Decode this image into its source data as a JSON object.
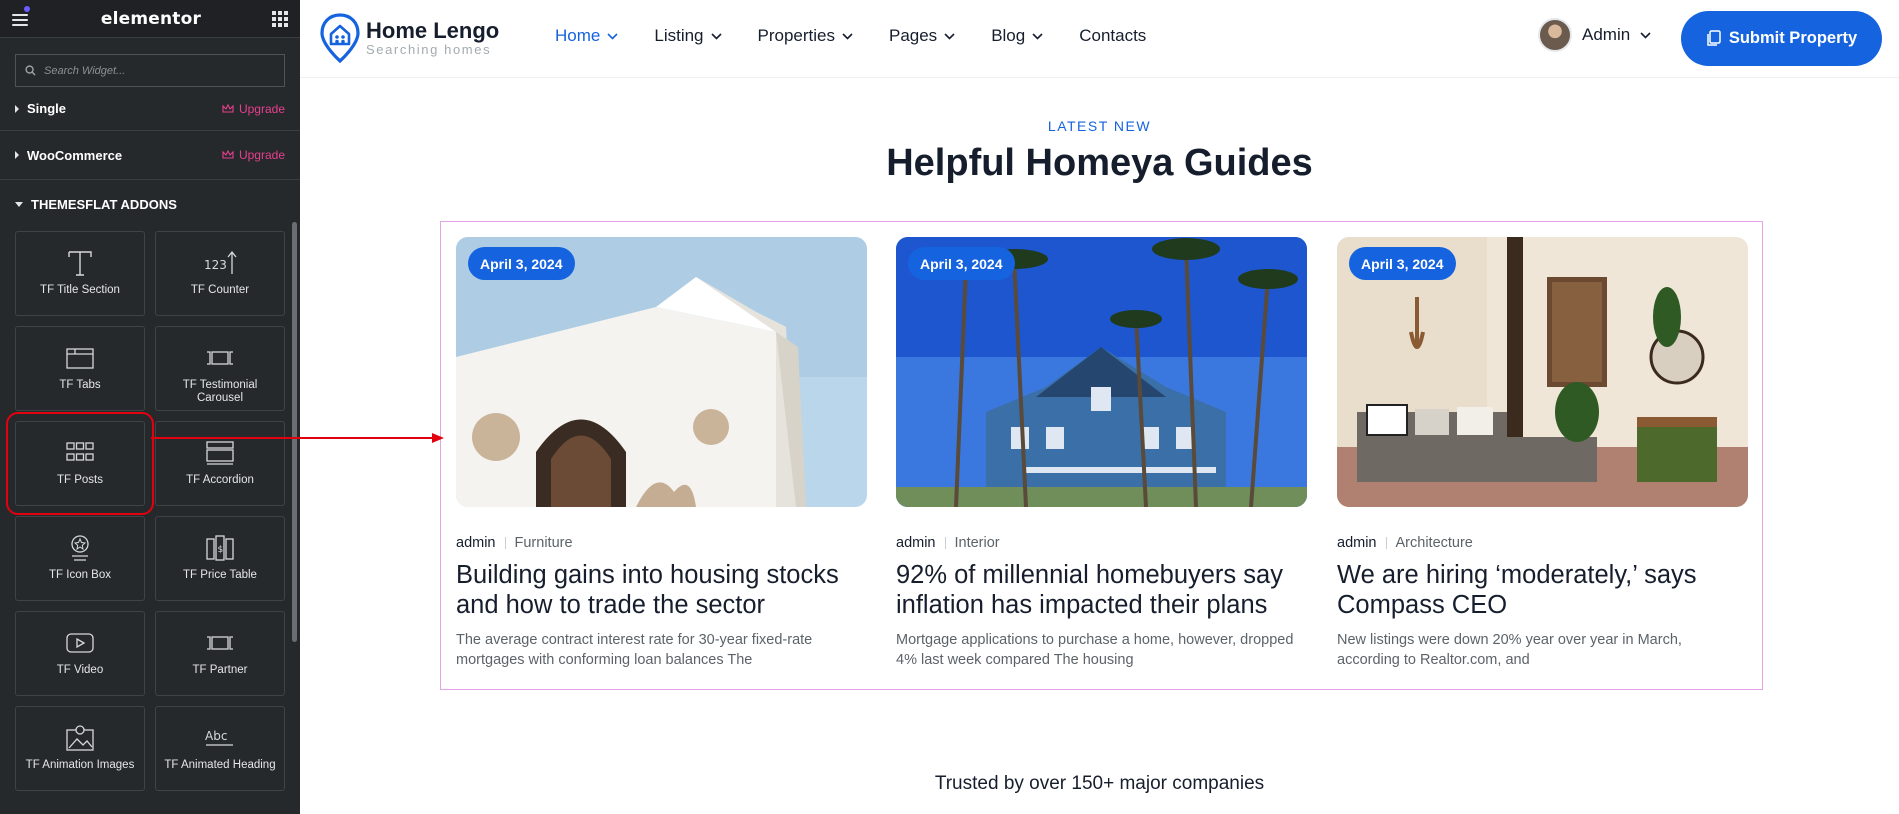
{
  "sidebar": {
    "logo": "elementor",
    "search_placeholder": "Search Widget...",
    "categories": [
      {
        "name": "Single",
        "upgrade": "Upgrade"
      },
      {
        "name": "WooCommerce",
        "upgrade": "Upgrade"
      },
      {
        "name": "THEMESFLAT ADDONS"
      }
    ],
    "widgets": [
      {
        "label": "TF Title Section",
        "icon": "title-section-icon"
      },
      {
        "label": "TF Counter",
        "icon": "counter-icon"
      },
      {
        "label": "TF Tabs",
        "icon": "tabs-icon"
      },
      {
        "label": "TF Testimonial Carousel",
        "icon": "carousel-icon"
      },
      {
        "label": "TF Posts",
        "icon": "posts-grid-icon"
      },
      {
        "label": "TF Accordion",
        "icon": "accordion-icon"
      },
      {
        "label": "TF Icon Box",
        "icon": "icon-box-icon"
      },
      {
        "label": "TF Price Table",
        "icon": "price-table-icon"
      },
      {
        "label": "TF Video",
        "icon": "video-icon"
      },
      {
        "label": "TF Partner",
        "icon": "partner-icon"
      },
      {
        "label": "TF Animation Images",
        "icon": "animation-images-icon"
      },
      {
        "label": "TF Animated Heading",
        "icon": "animated-heading-icon"
      }
    ]
  },
  "header": {
    "brand_name": "Home Lengo",
    "brand_tagline": "Searching homes",
    "nav": [
      {
        "label": "Home",
        "active": true,
        "dropdown": true
      },
      {
        "label": "Listing",
        "dropdown": true
      },
      {
        "label": "Properties",
        "dropdown": true
      },
      {
        "label": "Pages",
        "dropdown": true
      },
      {
        "label": "Blog",
        "dropdown": true
      },
      {
        "label": "Contacts",
        "dropdown": false
      }
    ],
    "user_name": "Admin",
    "submit_label": "Submit Property"
  },
  "section": {
    "subtitle": "LATEST NEW",
    "title": "Helpful Homeya Guides",
    "posts": [
      {
        "date": "April 3, 2024",
        "author": "admin",
        "category": "Furniture",
        "title": "Building gains into housing stocks and how to trade the sector",
        "excerpt": "The average contract interest rate for 30-year fixed-rate mortgages with conforming loan balances The"
      },
      {
        "date": "April 3, 2024",
        "author": "admin",
        "category": "Interior",
        "title": "92% of millennial homebuyers say inflation has impacted their plans",
        "excerpt": "Mortgage applications to purchase a home, however, dropped 4% last week compared The housing"
      },
      {
        "date": "April 3, 2024",
        "author": "admin",
        "category": "Architecture",
        "title": "We are hiring ‘moderately,’ says Compass CEO",
        "excerpt": "New listings were down 20% year over year in March, according to Realtor.com, and"
      }
    ],
    "trusted": "Trusted by over 150+ major companies"
  },
  "colors": {
    "accent": "#1563df",
    "sidebar_bg": "#26292c",
    "upgrade": "#e73f8e",
    "highlight": "#e3000f",
    "heading": "#161e2d"
  }
}
